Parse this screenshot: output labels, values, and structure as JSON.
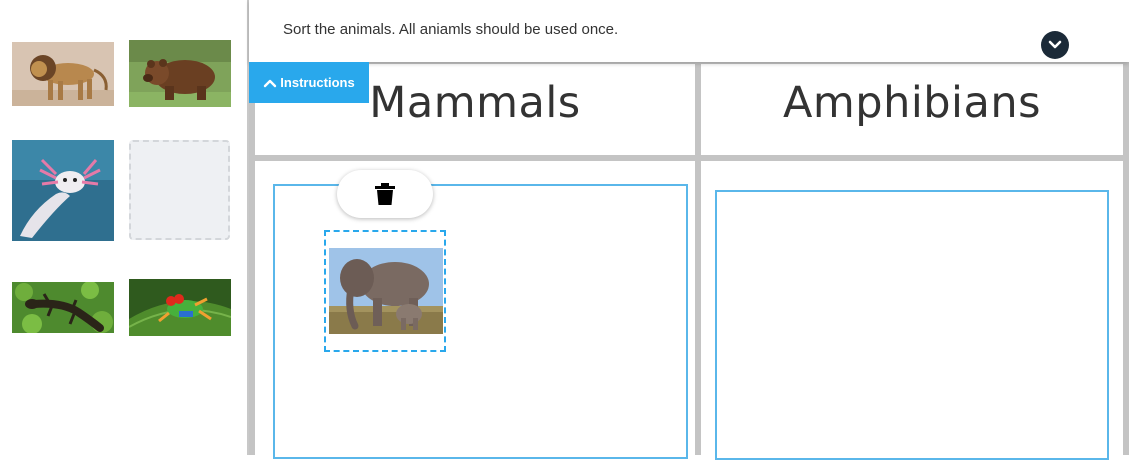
{
  "header": {
    "prompt": "Sort the animals. All aniamls should be used once."
  },
  "instructions_tab": {
    "label": "Instructions",
    "icon": "chevron-up-icon"
  },
  "collapse_button": {
    "icon": "chevron-down-icon"
  },
  "tray": {
    "tiles": [
      {
        "animal": "lion"
      },
      {
        "animal": "brown bear"
      },
      {
        "animal": "axolotl"
      },
      {
        "animal": "empty slot"
      },
      {
        "animal": "salamander"
      },
      {
        "animal": "tree frog"
      }
    ]
  },
  "columns": [
    {
      "title": "Mammals",
      "placed": [
        "elephant"
      ]
    },
    {
      "title": "Amphibians",
      "placed": []
    }
  ],
  "delete_button": {
    "icon": "trash-icon"
  },
  "colors": {
    "accent": "#29a8ec",
    "dropzone_border": "#5ab7ea",
    "board_gap": "#c4c4c4",
    "collapse_button": "#1b2a38"
  }
}
